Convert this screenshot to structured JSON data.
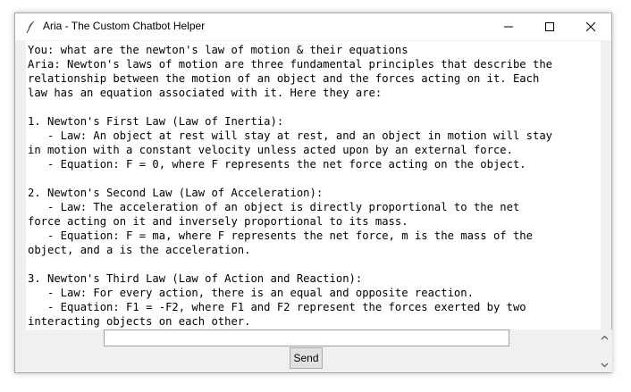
{
  "window": {
    "title": "Aria - The Custom Chatbot Helper",
    "icon": "feather-icon"
  },
  "chat": {
    "lines": [
      "You: what are the newton's law of motion & their equations",
      "Aria: Newton's laws of motion are three fundamental principles that describe the",
      "relationship between the motion of an object and the forces acting on it. Each",
      "law has an equation associated with it. Here they are:",
      "",
      "1. Newton's First Law (Law of Inertia):",
      "   - Law: An object at rest will stay at rest, and an object in motion will stay",
      "in motion with a constant velocity unless acted upon by an external force.",
      "   - Equation: F = 0, where F represents the net force acting on the object.",
      "",
      "2. Newton's Second Law (Law of Acceleration):",
      "   - Law: The acceleration of an object is directly proportional to the net",
      "force acting on it and inversely proportional to its mass.",
      "   - Equation: F = ma, where F represents the net force, m is the mass of the",
      "object, and a is the acceleration.",
      "",
      "3. Newton's Third Law (Law of Action and Reaction):",
      "   - Law: For every action, there is an equal and opposite reaction.",
      "   - Equation: F1 = -F2, where F1 and F2 represent the forces exerted by two",
      "interacting objects on each other."
    ]
  },
  "input": {
    "value": "",
    "placeholder": ""
  },
  "send": {
    "label": "Send"
  }
}
